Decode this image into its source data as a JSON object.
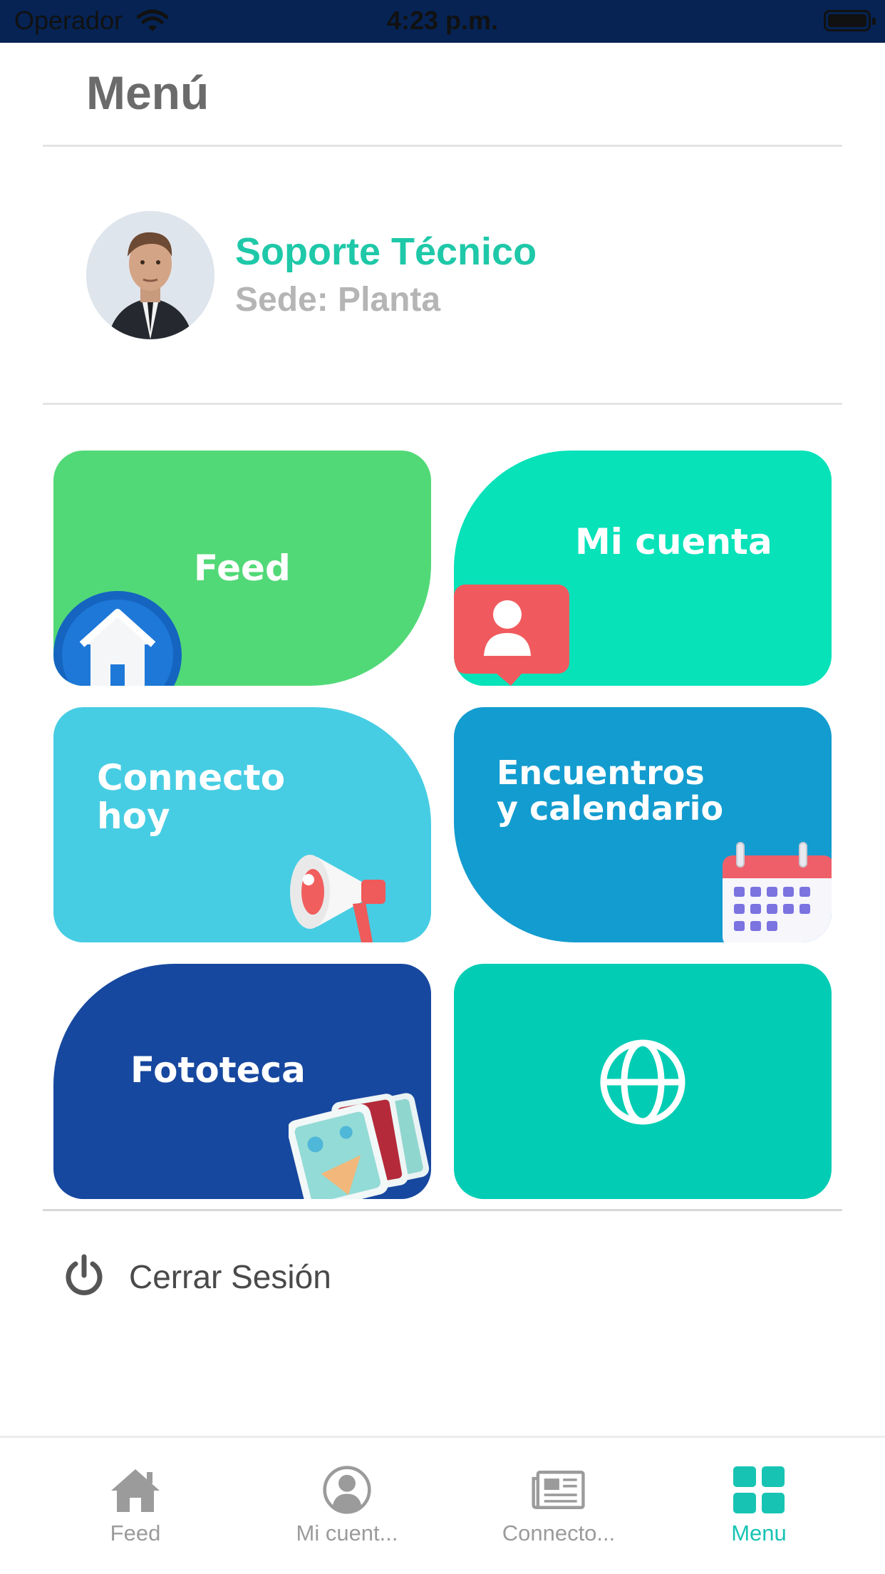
{
  "status_bar": {
    "carrier": "Operador",
    "time": "4:23 p.m."
  },
  "header": {
    "title": "Menú"
  },
  "profile": {
    "name": "Soporte Técnico",
    "sede": "Sede: Planta"
  },
  "tiles": [
    {
      "label": "Feed",
      "color": "#52d977",
      "icon": "home-icon"
    },
    {
      "label": "Mi cuenta",
      "color": "#07e2b9",
      "icon": "user-badge-icon"
    },
    {
      "label_line1": "Connecto",
      "label_line2": "hoy",
      "color": "#46cde3",
      "icon": "megaphone-icon"
    },
    {
      "label_line1": "Encuentros",
      "label_line2": "y calendario",
      "color": "#139ccf",
      "icon": "calendar-icon"
    },
    {
      "label": "Fototeca",
      "color": "#17489f",
      "icon": "photos-icon"
    },
    {
      "label": "",
      "color": "#02cdb4",
      "icon": "globe-icon"
    }
  ],
  "logout": {
    "label": "Cerrar Sesión",
    "icon": "power-icon"
  },
  "tabbar": {
    "active_color": "#17c4b4",
    "items": [
      {
        "label": "Feed",
        "icon": "home-icon"
      },
      {
        "label": "Mi cuent...",
        "icon": "account-icon"
      },
      {
        "label": "Connecto...",
        "icon": "newspaper-icon"
      },
      {
        "label": "Menu",
        "icon": "grid-icon",
        "active": true
      }
    ]
  }
}
